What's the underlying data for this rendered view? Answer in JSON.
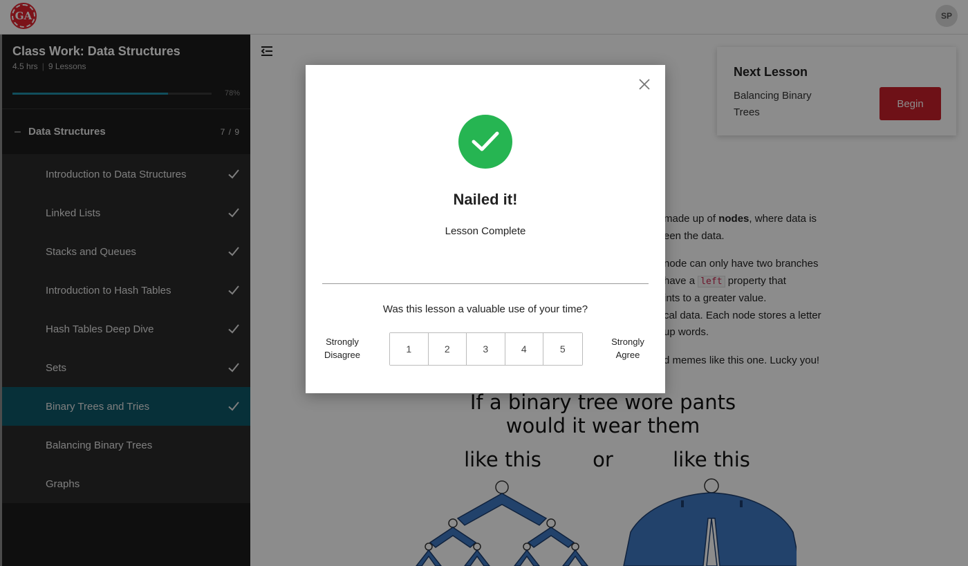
{
  "topbar": {
    "logo_text": "GA",
    "avatar_initials": "SP"
  },
  "sidebar": {
    "course_title": "Class Work: Data Structures",
    "duration": "4.5 hrs",
    "lesson_count": "9 Lessons",
    "progress_percent_label": "78%",
    "progress_value": 0.78,
    "section": {
      "toggle": "–",
      "title": "Data Structures",
      "count": "7 / 9"
    },
    "lessons": [
      {
        "label": "Introduction to Data Structures",
        "completed": true
      },
      {
        "label": "Linked Lists",
        "completed": true
      },
      {
        "label": "Stacks and Queues",
        "completed": true
      },
      {
        "label": "Introduction to Hash Tables",
        "completed": true
      },
      {
        "label": "Hash Tables Deep Dive",
        "completed": true
      },
      {
        "label": "Sets",
        "completed": true
      },
      {
        "label": "Binary Trees and Tries",
        "completed": true,
        "active": true
      },
      {
        "label": "Balancing Binary Trees",
        "completed": false
      },
      {
        "label": "Graphs",
        "completed": false
      }
    ]
  },
  "next_lesson": {
    "heading": "Next Lesson",
    "name": "Balancing Binary Trees",
    "button_label": "Begin"
  },
  "article": {
    "p1_a": "made up of ",
    "p1_bold": "nodes",
    "p1_b": ", where data is",
    "p1_c": "een the data.",
    "p2_a": "node can only have two branches",
    "p2_b": "have a ",
    "p2_code": "left",
    "p2_c": " property that",
    "p2_d": "ints to a greater value.",
    "p2_e": "cal data. Each node stores a letter",
    "p2_f": "up words.",
    "p3": "d memes like this one. Lucky you!"
  },
  "meme": {
    "line1": "If a binary tree wore pants",
    "line2": "would it wear them",
    "left_caption": "like this",
    "middle": "or",
    "right_caption": "like this"
  },
  "modal": {
    "title": "Nailed it!",
    "subtitle": "Lesson Complete",
    "question": "Was this lesson a valuable use of your time?",
    "scale_low": "Strongly Disagree",
    "scale_high": "Strongly Agree",
    "ratings": [
      "1",
      "2",
      "3",
      "4",
      "5"
    ]
  },
  "colors": {
    "accent_red": "#c8202a",
    "success_green": "#26b552",
    "active_teal": "#0d5868",
    "progress_blue": "#1f8fa8"
  }
}
